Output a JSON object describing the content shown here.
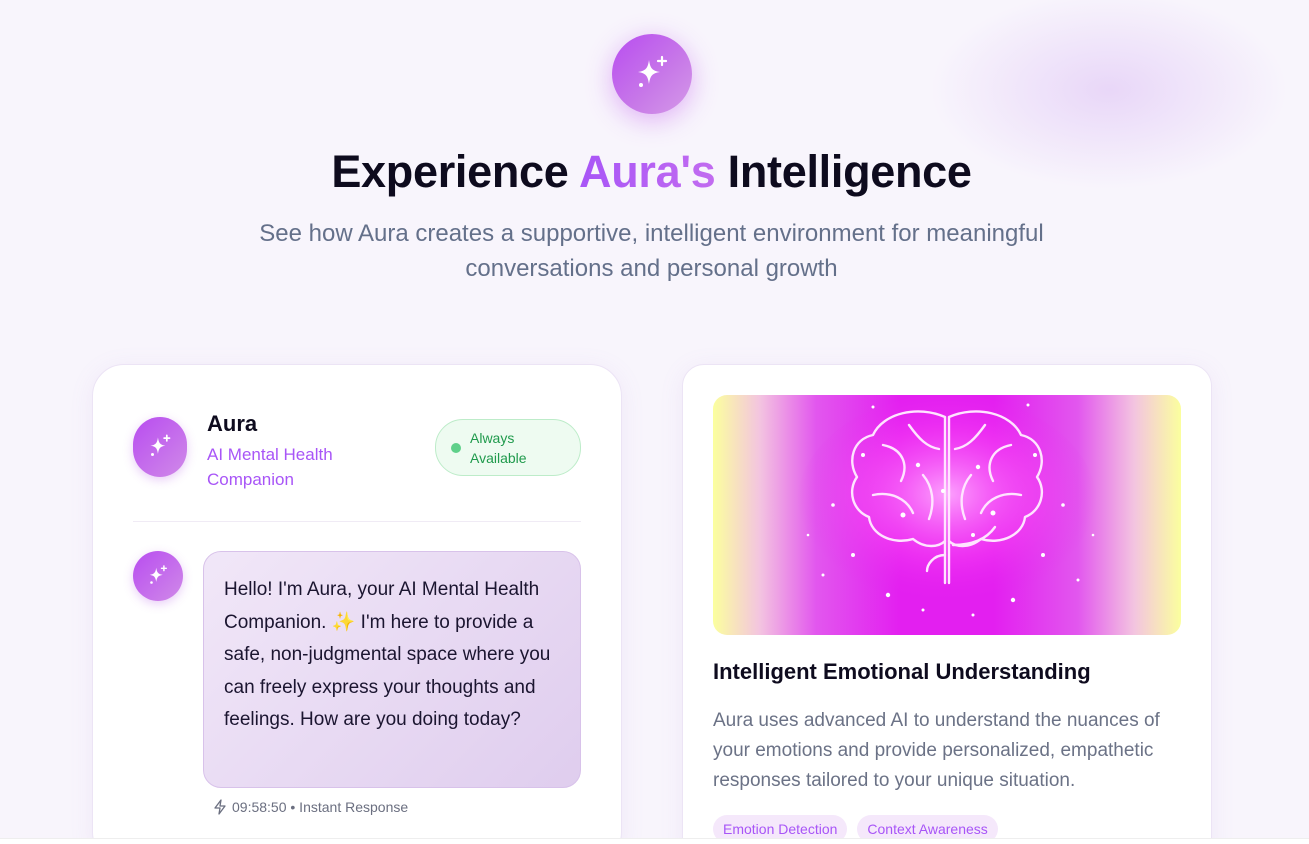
{
  "hero": {
    "icon": "sparkles-icon",
    "title_before": "Experience ",
    "title_accent": "Aura's",
    "title_after": " Intelligence",
    "subtitle": "See how Aura creates a supportive, intelligent environment for meaningful conversations and personal growth"
  },
  "chat_card": {
    "name": "Aura",
    "role": "AI Mental Health Companion",
    "status": "Always Available",
    "message": "Hello! I'm Aura, your AI Mental Health Companion. ✨ I'm here to provide a safe, non-judgmental space where you can freely express your thoughts and feelings. How are you doing today?",
    "meta": "09:58:50 • Instant Response"
  },
  "feature_card": {
    "title": "Intelligent Emotional Understanding",
    "description": "Aura uses advanced AI to understand the nuances of your emotions and provide personalized, empathetic responses tailored to your unique situation.",
    "tags": [
      "Emotion Detection",
      "Context Awareness"
    ]
  },
  "colors": {
    "accent": "#a855f7",
    "status_green": "#1f9a4c",
    "status_bg": "#eefbf1"
  }
}
